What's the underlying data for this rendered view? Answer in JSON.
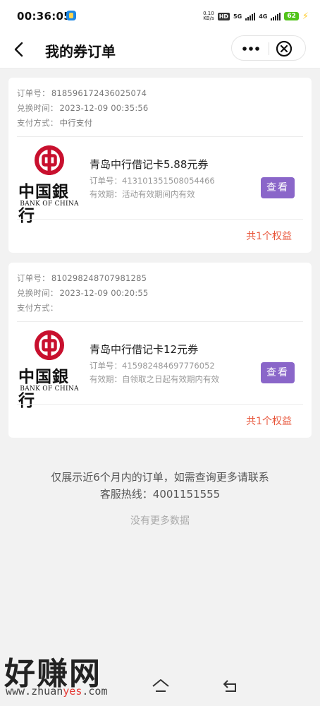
{
  "status_bar": {
    "time": "00:36:05",
    "net_speed_top": "0.10",
    "net_speed_bottom": "KB/s",
    "hd_label": "HD",
    "net1": "5G",
    "net2": "4G",
    "battery": "62"
  },
  "nav": {
    "title": "我的券订单"
  },
  "orders": [
    {
      "order_no_label": "订单号：",
      "order_no": "818596172436025074",
      "redeem_time_label": "兑换时间：",
      "redeem_time": "2023-12-09 00:35:56",
      "payment_label": "支付方式：",
      "payment": "中行支付",
      "logo_cn": "中国銀行",
      "logo_en": "BANK OF CHINA",
      "product_name": "青岛中行借记卡5.88元券",
      "item_no_label": "订单号：",
      "item_no": "413101351508054466",
      "validity_label": "有效期：",
      "validity": "活动有效期间内有效",
      "view_label": "查看",
      "total": "共1个权益"
    },
    {
      "order_no_label": "订单号：",
      "order_no": "810298248707981285",
      "redeem_time_label": "兑换时间：",
      "redeem_time": "2023-12-09 00:20:55",
      "payment_label": "支付方式：",
      "payment": "",
      "logo_cn": "中国銀行",
      "logo_en": "BANK OF CHINA",
      "product_name": "青岛中行借记卡12元券",
      "item_no_label": "订单号：",
      "item_no": "415982484697776052",
      "validity_label": "有效期：",
      "validity": "自领取之日起有效期内有效",
      "view_label": "查看",
      "total": "共1个权益"
    }
  ],
  "notice": {
    "line1": "仅展示近6个月内的订单，如需查询更多请联系",
    "line2": "客服热线：4001151555",
    "no_more": "没有更多数据"
  },
  "watermark": {
    "cn": "好赚网",
    "url_a": "www.zhuan",
    "url_b": "yes",
    "url_c": ".com"
  },
  "colors": {
    "accent_button": "#8a66c9",
    "total_text": "#e8553a",
    "bank_red": "#c8102e"
  }
}
